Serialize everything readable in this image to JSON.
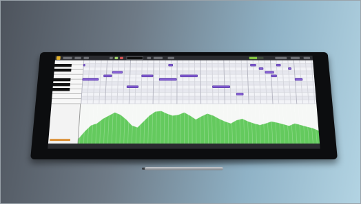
{
  "scene": {
    "device": "tablet",
    "accessory": "stylus-pen"
  },
  "app": {
    "toolbar": {
      "time_display": "",
      "buttons": [
        "rewind-icon",
        "play-icon",
        "record-icon",
        "loop-icon"
      ]
    },
    "piano_roll": {
      "note_color": "#8a62d8",
      "notes": [
        {
          "pitch_row": 1,
          "start_beat": 0.0,
          "length_beats": 0.3
        },
        {
          "pitch_row": 1,
          "start_beat": 14.5,
          "length_beats": 0.8
        },
        {
          "pitch_row": 1,
          "start_beat": 28.5,
          "length_beats": 1.0
        },
        {
          "pitch_row": 1,
          "start_beat": 33.0,
          "length_beats": 0.8
        },
        {
          "pitch_row": 2,
          "start_beat": 30.0,
          "length_beats": 0.8
        },
        {
          "pitch_row": 2,
          "start_beat": 35.0,
          "length_beats": 0.5
        },
        {
          "pitch_row": 3,
          "start_beat": 5.0,
          "length_beats": 1.8
        },
        {
          "pitch_row": 3,
          "start_beat": 31.0,
          "length_beats": 1.5
        },
        {
          "pitch_row": 4,
          "start_beat": 3.5,
          "length_beats": 1.5
        },
        {
          "pitch_row": 4,
          "start_beat": 10.0,
          "length_beats": 2.0
        },
        {
          "pitch_row": 4,
          "start_beat": 16.5,
          "length_beats": 3.0
        },
        {
          "pitch_row": 4,
          "start_beat": 32.0,
          "length_beats": 1.0
        },
        {
          "pitch_row": 5,
          "start_beat": 0.0,
          "length_beats": 2.8
        },
        {
          "pitch_row": 5,
          "start_beat": 13.0,
          "length_beats": 3.0
        },
        {
          "pitch_row": 5,
          "start_beat": 36.0,
          "length_beats": 1.3
        },
        {
          "pitch_row": 7,
          "start_beat": 7.5,
          "length_beats": 2.0
        },
        {
          "pitch_row": 7,
          "start_beat": 22.0,
          "length_beats": 3.0
        },
        {
          "pitch_row": 9,
          "start_beat": 26.0,
          "length_beats": 1.2
        }
      ]
    },
    "velocity_lane": {
      "fill_color": "#54c44e",
      "levels": [
        0.12,
        0.3,
        0.45,
        0.5,
        0.62,
        0.7,
        0.78,
        0.72,
        0.6,
        0.45,
        0.4,
        0.55,
        0.7,
        0.8,
        0.82,
        0.75,
        0.7,
        0.72,
        0.78,
        0.7,
        0.6,
        0.68,
        0.75,
        0.7,
        0.62,
        0.55,
        0.5,
        0.58,
        0.62,
        0.55,
        0.5,
        0.46,
        0.5,
        0.55,
        0.52,
        0.48,
        0.44,
        0.5,
        0.46,
        0.42,
        0.38,
        0.32
      ]
    }
  }
}
